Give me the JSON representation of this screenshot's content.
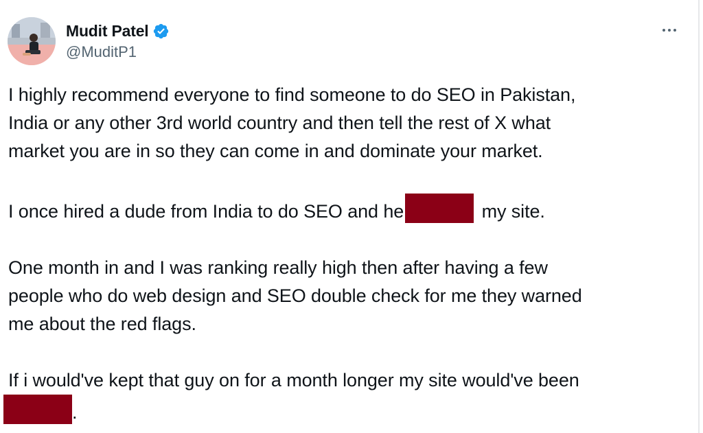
{
  "author": {
    "display_name": "Mudit Patel",
    "handle": "@MuditP1",
    "verified": true,
    "verified_color": "#1d9bf0",
    "avatar_icon": "profile-photo"
  },
  "actions": {
    "more_icon": "ellipsis-icon"
  },
  "tweet": {
    "p1": [
      "I highly recommend everyone to find someone to do SEO in Pakistan,",
      "India or any other 3rd world country and then tell the rest of X what",
      "market you are in so they can come in and dominate your market."
    ],
    "p2_before": "I once hired a dude from India to do SEO and he",
    "p2_after": " my site.",
    "p3": [
      "One month in and I was ranking really high then after having a few",
      "people who do web design and SEO double check for me they warned",
      "me about the red flags."
    ],
    "p4": "If i would've kept that guy on for a month longer my site would've been",
    "p4_end": ".",
    "redaction_color": "#8b0016"
  }
}
